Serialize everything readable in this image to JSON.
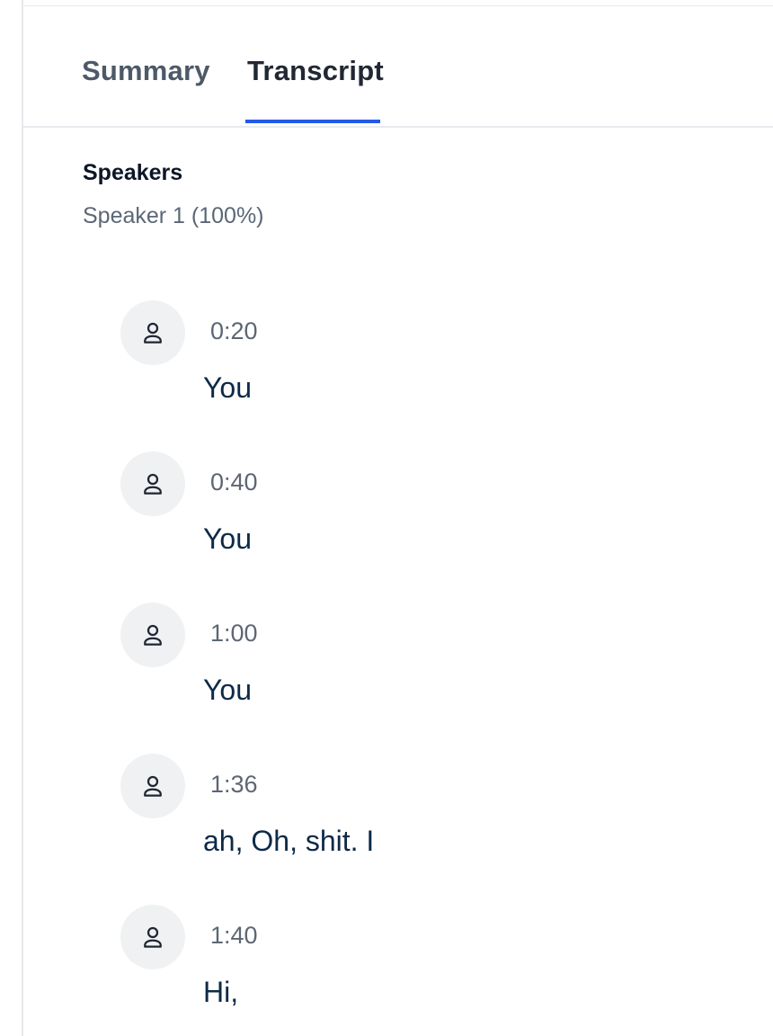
{
  "tabs": [
    {
      "label": "Summary",
      "active": false
    },
    {
      "label": "Transcript",
      "active": true
    }
  ],
  "speakers": {
    "title": "Speakers",
    "items": [
      {
        "label": "Speaker 1 (100%)"
      }
    ]
  },
  "transcript": {
    "entries": [
      {
        "time": "0:20",
        "text": "You",
        "icon": "user-icon"
      },
      {
        "time": "0:40",
        "text": "You",
        "icon": "user-icon"
      },
      {
        "time": "1:00",
        "text": "You",
        "icon": "user-icon"
      },
      {
        "time": "1:36",
        "text": "ah, Oh, shit. I",
        "icon": "user-icon"
      },
      {
        "time": "1:40",
        "text": "Hi,",
        "icon": "user-icon"
      }
    ]
  },
  "colors": {
    "accent": "#2459e8",
    "text_primary": "#0d2a47",
    "text_muted": "#5d6674",
    "avatar_bg": "#f0f1f3"
  }
}
